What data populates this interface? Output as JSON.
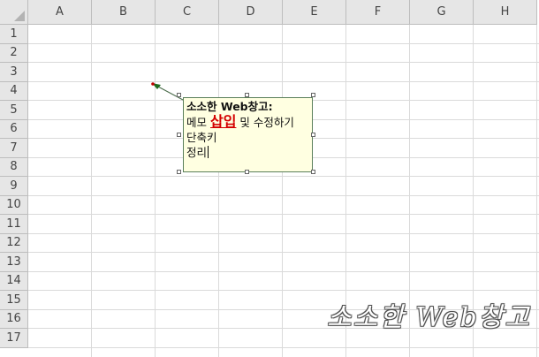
{
  "columns": [
    "A",
    "B",
    "C",
    "D",
    "E",
    "F",
    "G",
    "H"
  ],
  "rows": [
    "1",
    "2",
    "3",
    "4",
    "5",
    "6",
    "7",
    "8",
    "9",
    "10",
    "11",
    "12",
    "13",
    "14",
    "15",
    "16",
    "17"
  ],
  "comment": {
    "title": "소소한 Web창고:",
    "line1_pre": "메모 ",
    "line1_highlight": "삽입",
    "line1_post": " 및 수정하기",
    "line2": "단축키",
    "line3": "정리"
  },
  "watermark": "소소한 Web창고",
  "colors": {
    "comment_bg": "#ffffe1",
    "comment_border": "#5a7f5a",
    "highlight": "#d40000",
    "header_bg": "#e6e6e6",
    "gridline": "#dadada"
  }
}
